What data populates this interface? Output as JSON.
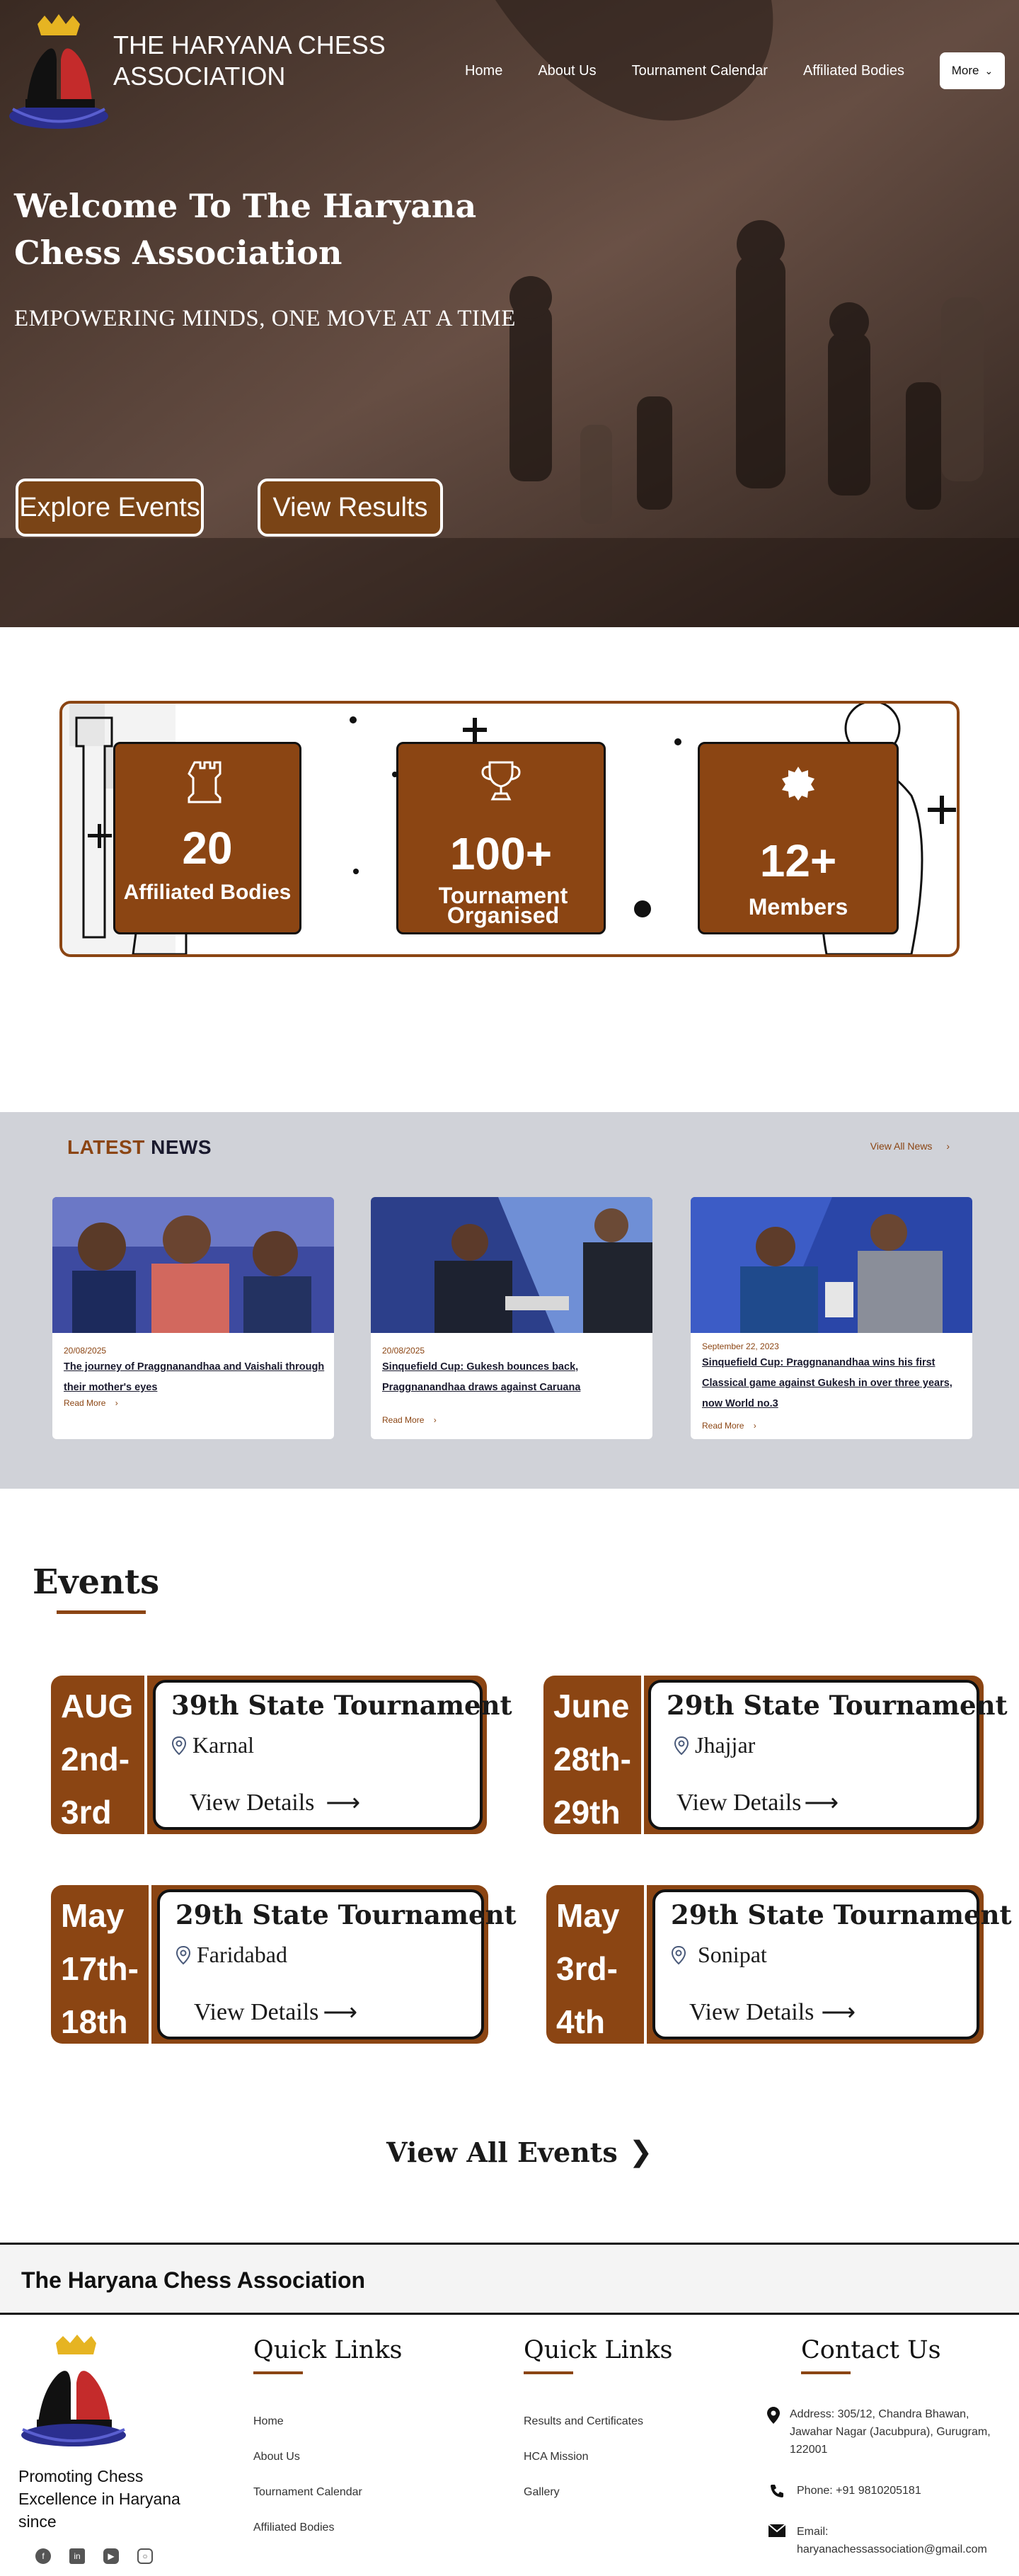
{
  "header": {
    "title": "THE HARYANA CHESS ASSOCIATION",
    "nav": [
      "Home",
      "About Us",
      "Tournament Calendar",
      "Affiliated Bodies"
    ],
    "more_label": "More"
  },
  "hero": {
    "title": "Welcome To The Haryana Chess Association",
    "tagline": "EMPOWERING MINDS, ONE MOVE AT A TIME",
    "explore_label": "Explore Events",
    "results_label": "View Results"
  },
  "stats": [
    {
      "value": "20",
      "label": "Affiliated Bodies",
      "icon": "rook-icon"
    },
    {
      "value": "100+",
      "label": "Tournament Organised",
      "icon": "trophy-icon"
    },
    {
      "value": "12+",
      "label": "Members",
      "icon": "badge-icon"
    }
  ],
  "news": {
    "heading_latest": "LATEST",
    "heading_news": "NEWS",
    "view_all": "View All News",
    "items": [
      {
        "date": "20/08/2025",
        "title": "The journey of Praggnanandhaa and Vaishali through their mother's eyes",
        "more": "Read More"
      },
      {
        "date": "20/08/2025",
        "title": "Sinquefield Cup: Gukesh bounces back, Praggnanandhaa draws against Caruana",
        "more": "Read More"
      },
      {
        "date": "September 22, 2023",
        "title": "Sinquefield Cup: Praggnanandhaa wins his first Classical game against Gukesh in over three years, now World no.3",
        "more": "Read More"
      }
    ]
  },
  "events": {
    "title": "Events",
    "items": [
      {
        "month": "AUG",
        "days1": "2nd-",
        "days2": "3rd",
        "name": "39th State Tournament",
        "location": "Karnal",
        "details": "View Details"
      },
      {
        "month": "June",
        "days1": "28th-",
        "days2": "29th",
        "name": "29th State Tournament",
        "location": "Jhajjar",
        "details": "View Details"
      },
      {
        "month": "May",
        "days1": "17th-",
        "days2": "18th",
        "name": "29th State Tournament",
        "location": "Faridabad",
        "details": "View Details"
      },
      {
        "month": "May",
        "days1": "3rd-",
        "days2": "4th",
        "name": "29th State Tournament",
        "location": "Sonipat",
        "details": "View Details"
      }
    ],
    "view_all": "View All Events"
  },
  "footer": {
    "brand": "The Haryana Chess Association",
    "about": "Promoting Chess Excellence in Haryana since",
    "col1_title": "Quick Links",
    "col1_links": [
      "Home",
      "About Us",
      "Tournament Calendar",
      "Affiliated Bodies"
    ],
    "col2_title": "Quick Links",
    "col2_links": [
      "Results and Certificates",
      "HCA Mission",
      "Gallery"
    ],
    "contact_title": "Contact Us",
    "address": "Address: 305/12, Chandra Bhawan, Jawahar Nagar (Jacubpura), Gurugram, 122001",
    "phone": "Phone: +91 9810205181",
    "email_label": "Email:",
    "email": "haryanachessassociation@gmail.com",
    "socials": [
      "facebook-icon",
      "linkedin-icon",
      "youtube-icon",
      "instagram-icon"
    ]
  },
  "colors": {
    "brand": "#8b4513",
    "news_bg": "#d0d2d8",
    "dark": "#111111"
  }
}
